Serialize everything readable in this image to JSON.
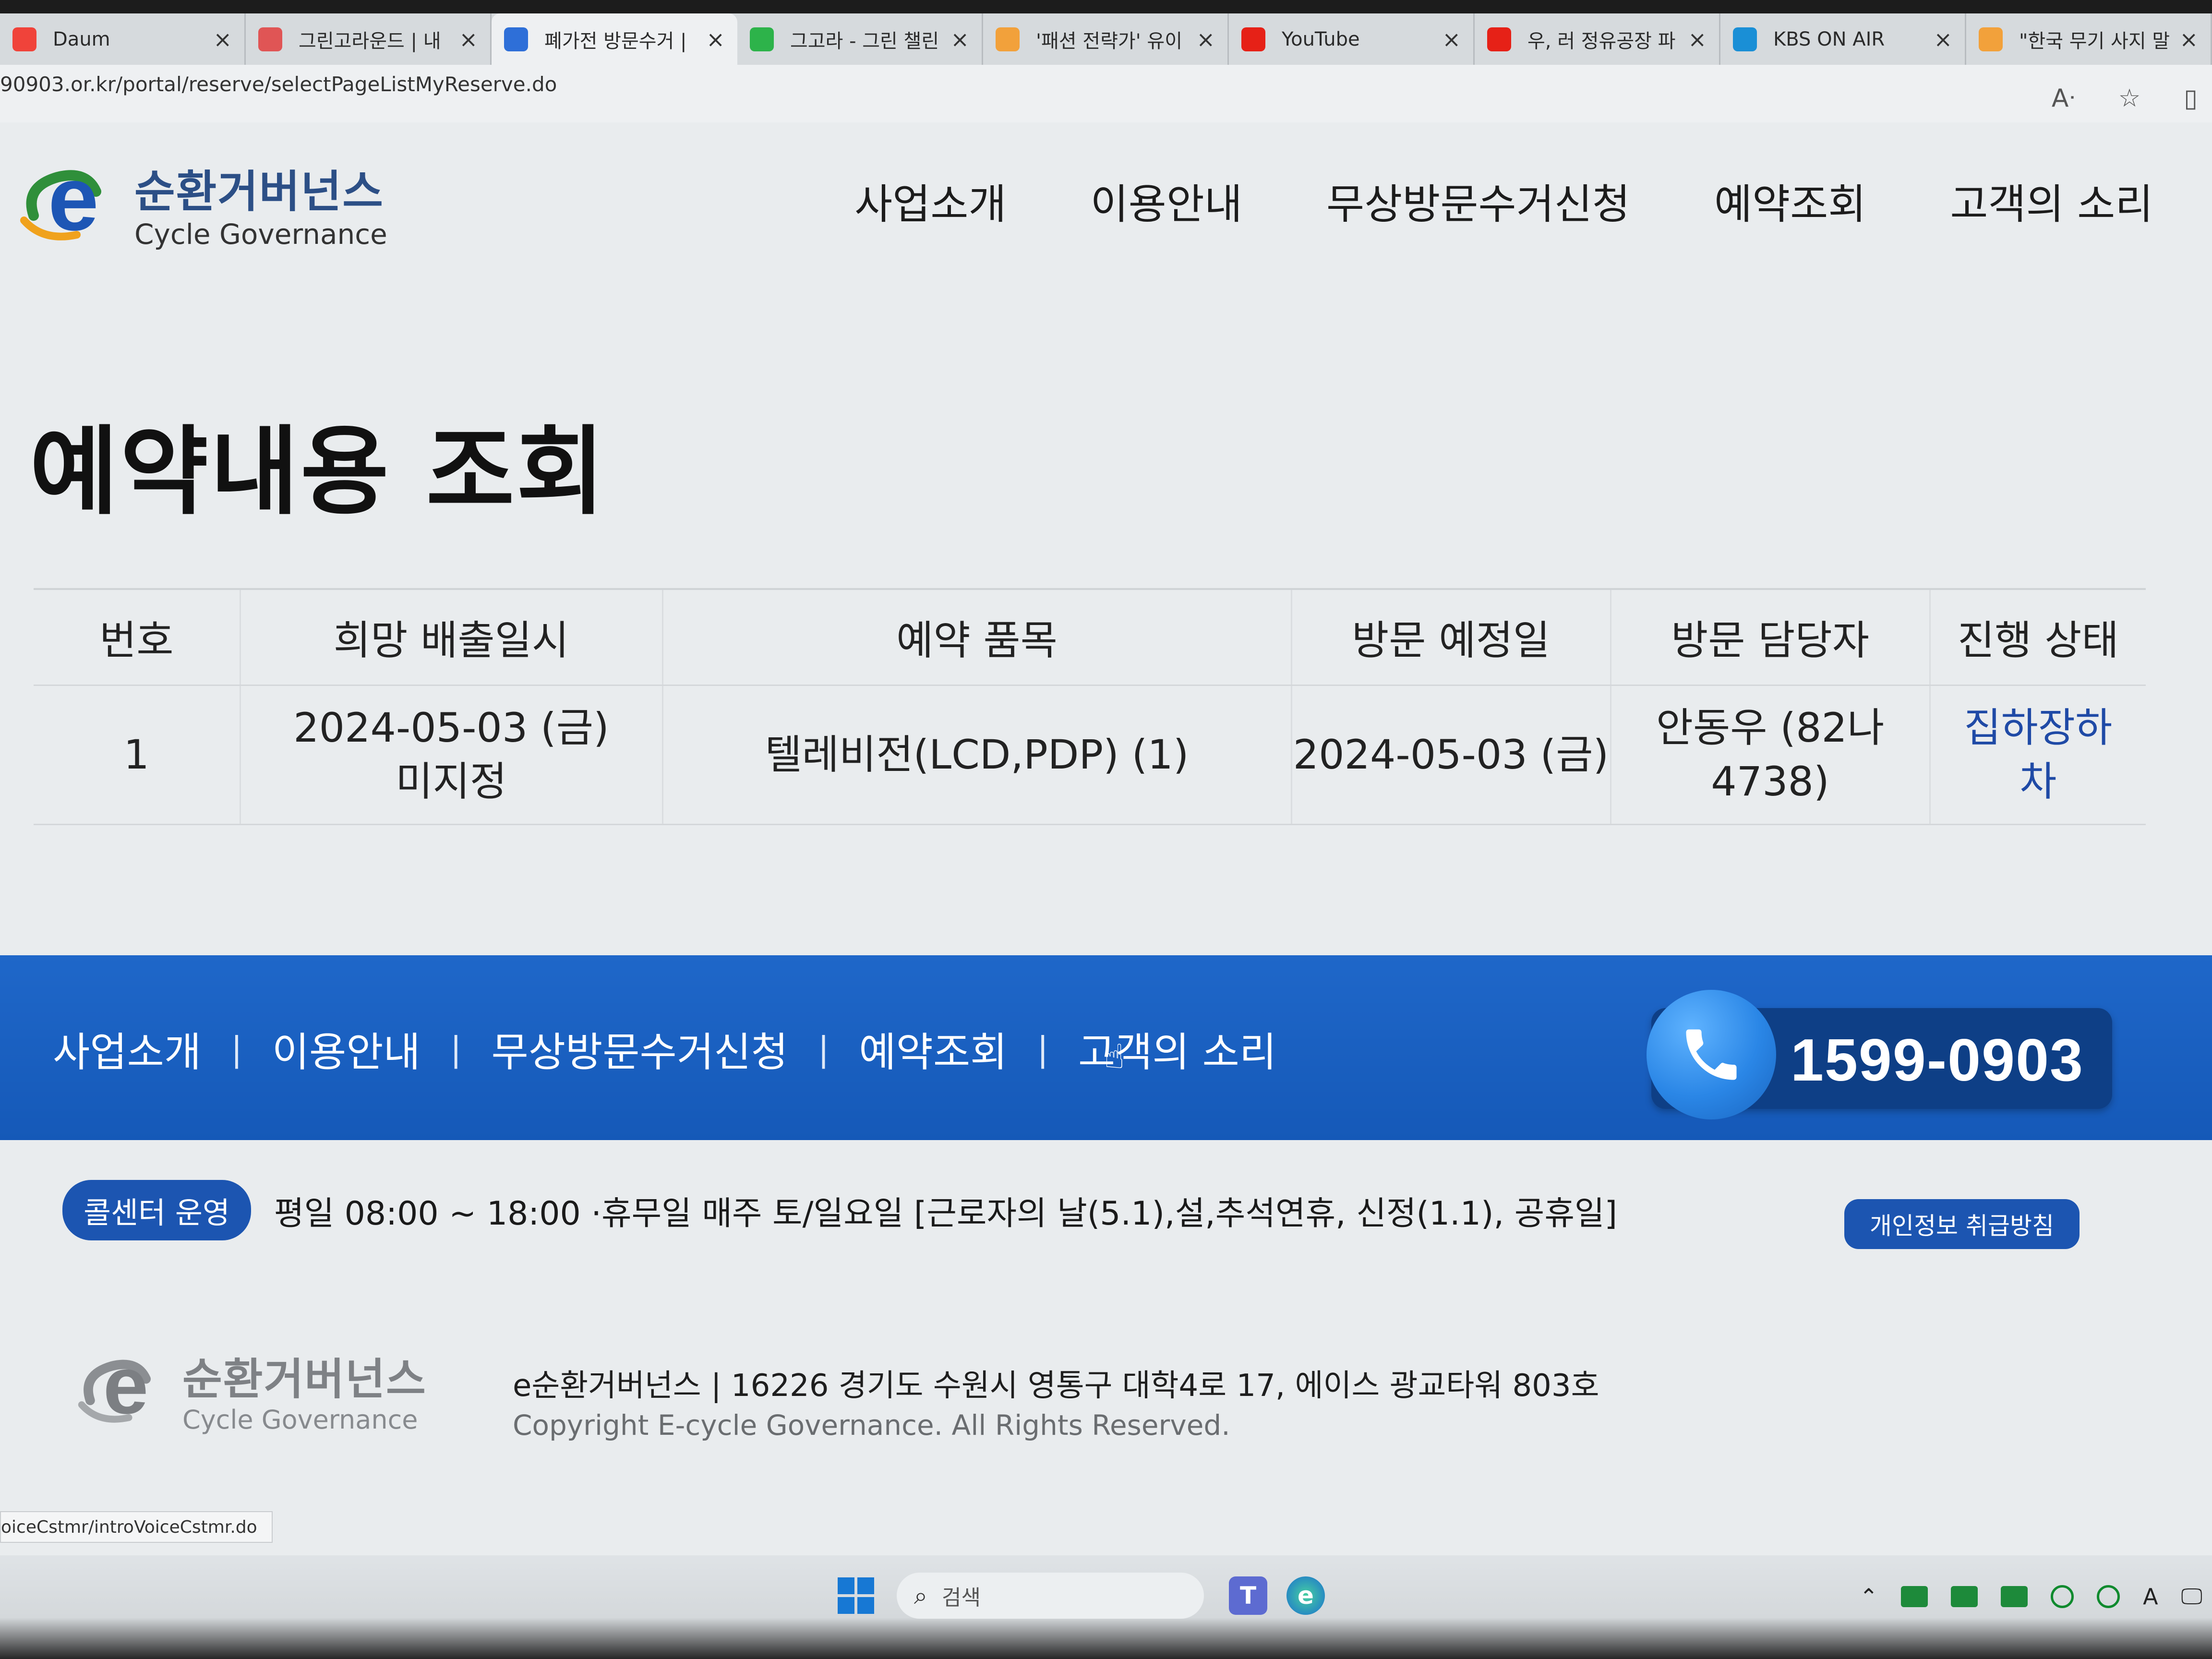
{
  "browser": {
    "tabs": [
      {
        "title": "Daum",
        "color": "#f0433a",
        "active": false
      },
      {
        "title": "그린고라운드 | 내",
        "color": "#e05555",
        "active": false
      },
      {
        "title": "폐가전 방문수거 |",
        "color": "#2e6fd8",
        "active": true
      },
      {
        "title": "그고라 - 그린 챌린",
        "color": "#2db34a",
        "active": false
      },
      {
        "title": "'패션 전략가' 유이",
        "color": "#f2a13b",
        "active": false
      },
      {
        "title": "YouTube",
        "color": "#e62117",
        "active": false
      },
      {
        "title": "우, 러 정유공장 파",
        "color": "#e62117",
        "active": false
      },
      {
        "title": "KBS ON AIR",
        "color": "#1a8fd6",
        "active": false
      },
      {
        "title": "\"한국 무기 사지 말",
        "color": "#f2a13b",
        "active": false
      }
    ],
    "close_glyph": "×",
    "url": "90903.or.kr/portal/reserve/selectPageListMyReserve.do",
    "status_url": "oiceCstmr/introVoiceCstmr.do"
  },
  "site": {
    "logo_kor": "순환거버넌스",
    "logo_eng": "Cycle Governance",
    "nav": [
      "사업소개",
      "이용안내",
      "무상방문수거신청",
      "예약조회",
      "고객의 소리"
    ],
    "brand_color": "#1c55b1"
  },
  "page": {
    "title": "예약내용 조회"
  },
  "table": {
    "headers": [
      "번호",
      "희망 배출일시",
      "예약 품목",
      "방문 예정일",
      "방문 담당자",
      "진행 상태"
    ],
    "rows": [
      {
        "no": "1",
        "wish_date": "2024-05-03 (금)",
        "wish_time": "미지정",
        "item": "텔레비전(LCD,PDP) (1)",
        "visit_date": "2024-05-03 (금)",
        "staff_line1": "안동우 (82나",
        "staff_line2": "4738)",
        "status_line1": "집하장하",
        "status_line2": "차"
      }
    ]
  },
  "footer": {
    "nav": [
      "사업소개",
      "이용안내",
      "무상방문수거신청",
      "예약조회",
      "고객의 소리"
    ],
    "separator": "|",
    "phone": "1599-0903",
    "callcenter_badge": "콜센터 운영",
    "callcenter_hours": "평일 08:00 ~ 18:00 ·휴무일 매주 토/일요일   [근로자의 날(5.1),설,추석연휴, 신정(1.1), 공휴일]",
    "privacy_button": "개인정보 취급방침",
    "company_address": "e순환거버넌스  | 16226 경기도 수원시 영통구 대학4로 17, 에이스 광교타워 803호",
    "copyright": "Copyright E-cycle Governance. All Rights Reserved."
  },
  "taskbar": {
    "search_placeholder": "검색"
  }
}
